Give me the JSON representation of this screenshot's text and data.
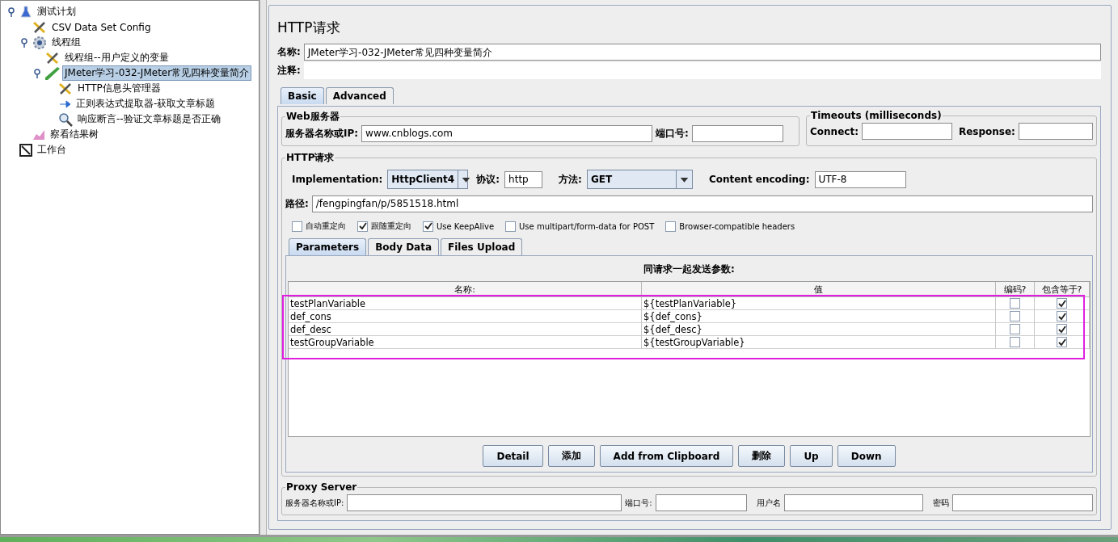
{
  "tree": [
    {
      "label": "测试计划",
      "kind": "flask",
      "selected": false,
      "children": [
        {
          "label": "CSV Data Set Config",
          "kind": "tools",
          "selected": false
        },
        {
          "label": "线程组",
          "kind": "gear",
          "selected": false,
          "children": [
            {
              "label": "线程组--用户定义的变量",
              "kind": "tools",
              "selected": false
            },
            {
              "label": "JMeter学习-032-JMeter常见四种变量简介",
              "kind": "pen",
              "selected": true,
              "children": [
                {
                  "label": "HTTP信息头管理器",
                  "kind": "tools",
                  "selected": false
                },
                {
                  "label": "正则表达式提取器-获取文章标题",
                  "kind": "extract",
                  "selected": false
                },
                {
                  "label": "响应断言--验证文章标题是否正确",
                  "kind": "magnifier",
                  "selected": false
                }
              ]
            }
          ]
        },
        {
          "label": "察看结果树",
          "kind": "chart",
          "selected": false
        }
      ]
    },
    {
      "label": "工作台",
      "kind": "bench",
      "selected": false
    }
  ],
  "editor": {
    "title": "HTTP请求",
    "name_label": "名称:",
    "name_value": "JMeter学习-032-JMeter常见四种变量简介",
    "comment_label": "注释:",
    "tabs": [
      {
        "label": "Basic",
        "selected": true
      },
      {
        "label": "Advanced",
        "selected": false
      }
    ],
    "web_server": {
      "title": "Web服务器",
      "server_label": "服务器名称或IP:",
      "server_value": "www.cnblogs.com",
      "port_label": "端口号:"
    },
    "timeouts": {
      "title": "Timeouts (milliseconds)",
      "connect_label": "Connect:",
      "response_label": "Response:"
    },
    "http_request": {
      "title": "HTTP请求",
      "implementation_label": "Implementation:",
      "implementation_value": "HttpClient4",
      "protocol_label": "协议:",
      "protocol_value": "http",
      "method_label": "方法:",
      "method_value": "GET",
      "encoding_label": "Content encoding:",
      "encoding_value": "UTF-8",
      "path_label": "路径:",
      "path_value": "/fengpingfan/p/5851518.html",
      "options": [
        {
          "label": "自动重定向",
          "checked": false
        },
        {
          "label": "跟随重定向",
          "checked": true
        },
        {
          "label": "Use KeepAlive",
          "checked": true
        },
        {
          "label": "Use multipart/form-data for POST",
          "checked": false
        },
        {
          "label": "Browser-compatible headers",
          "checked": false
        }
      ]
    },
    "sub_tabs": [
      {
        "label": "Parameters",
        "selected": true
      },
      {
        "label": "Body Data",
        "selected": false
      },
      {
        "label": "Files Upload",
        "selected": false
      }
    ],
    "parameters": {
      "caption": "同请求一起发送参数:",
      "columns": [
        "名称:",
        "值",
        "编码?",
        "包含等于?"
      ],
      "rows": [
        {
          "name": "testPlanVariable",
          "value": "${testPlanVariable}",
          "encode": false,
          "include_equals": true
        },
        {
          "name": "def_cons",
          "value": "${def_cons}",
          "encode": false,
          "include_equals": true
        },
        {
          "name": "def_desc",
          "value": "${def_desc}",
          "encode": false,
          "include_equals": true
        },
        {
          "name": "testGroupVariable",
          "value": "${testGroupVariable}",
          "encode": false,
          "include_equals": true
        }
      ]
    },
    "buttons": [
      "Detail",
      "添加",
      "Add from Clipboard",
      "删除",
      "Up",
      "Down"
    ],
    "proxy": {
      "title": "Proxy Server",
      "server_label": "服务器名称或IP:",
      "port_label": "端口号:",
      "user_label": "用户名",
      "password_label": "密码"
    }
  }
}
